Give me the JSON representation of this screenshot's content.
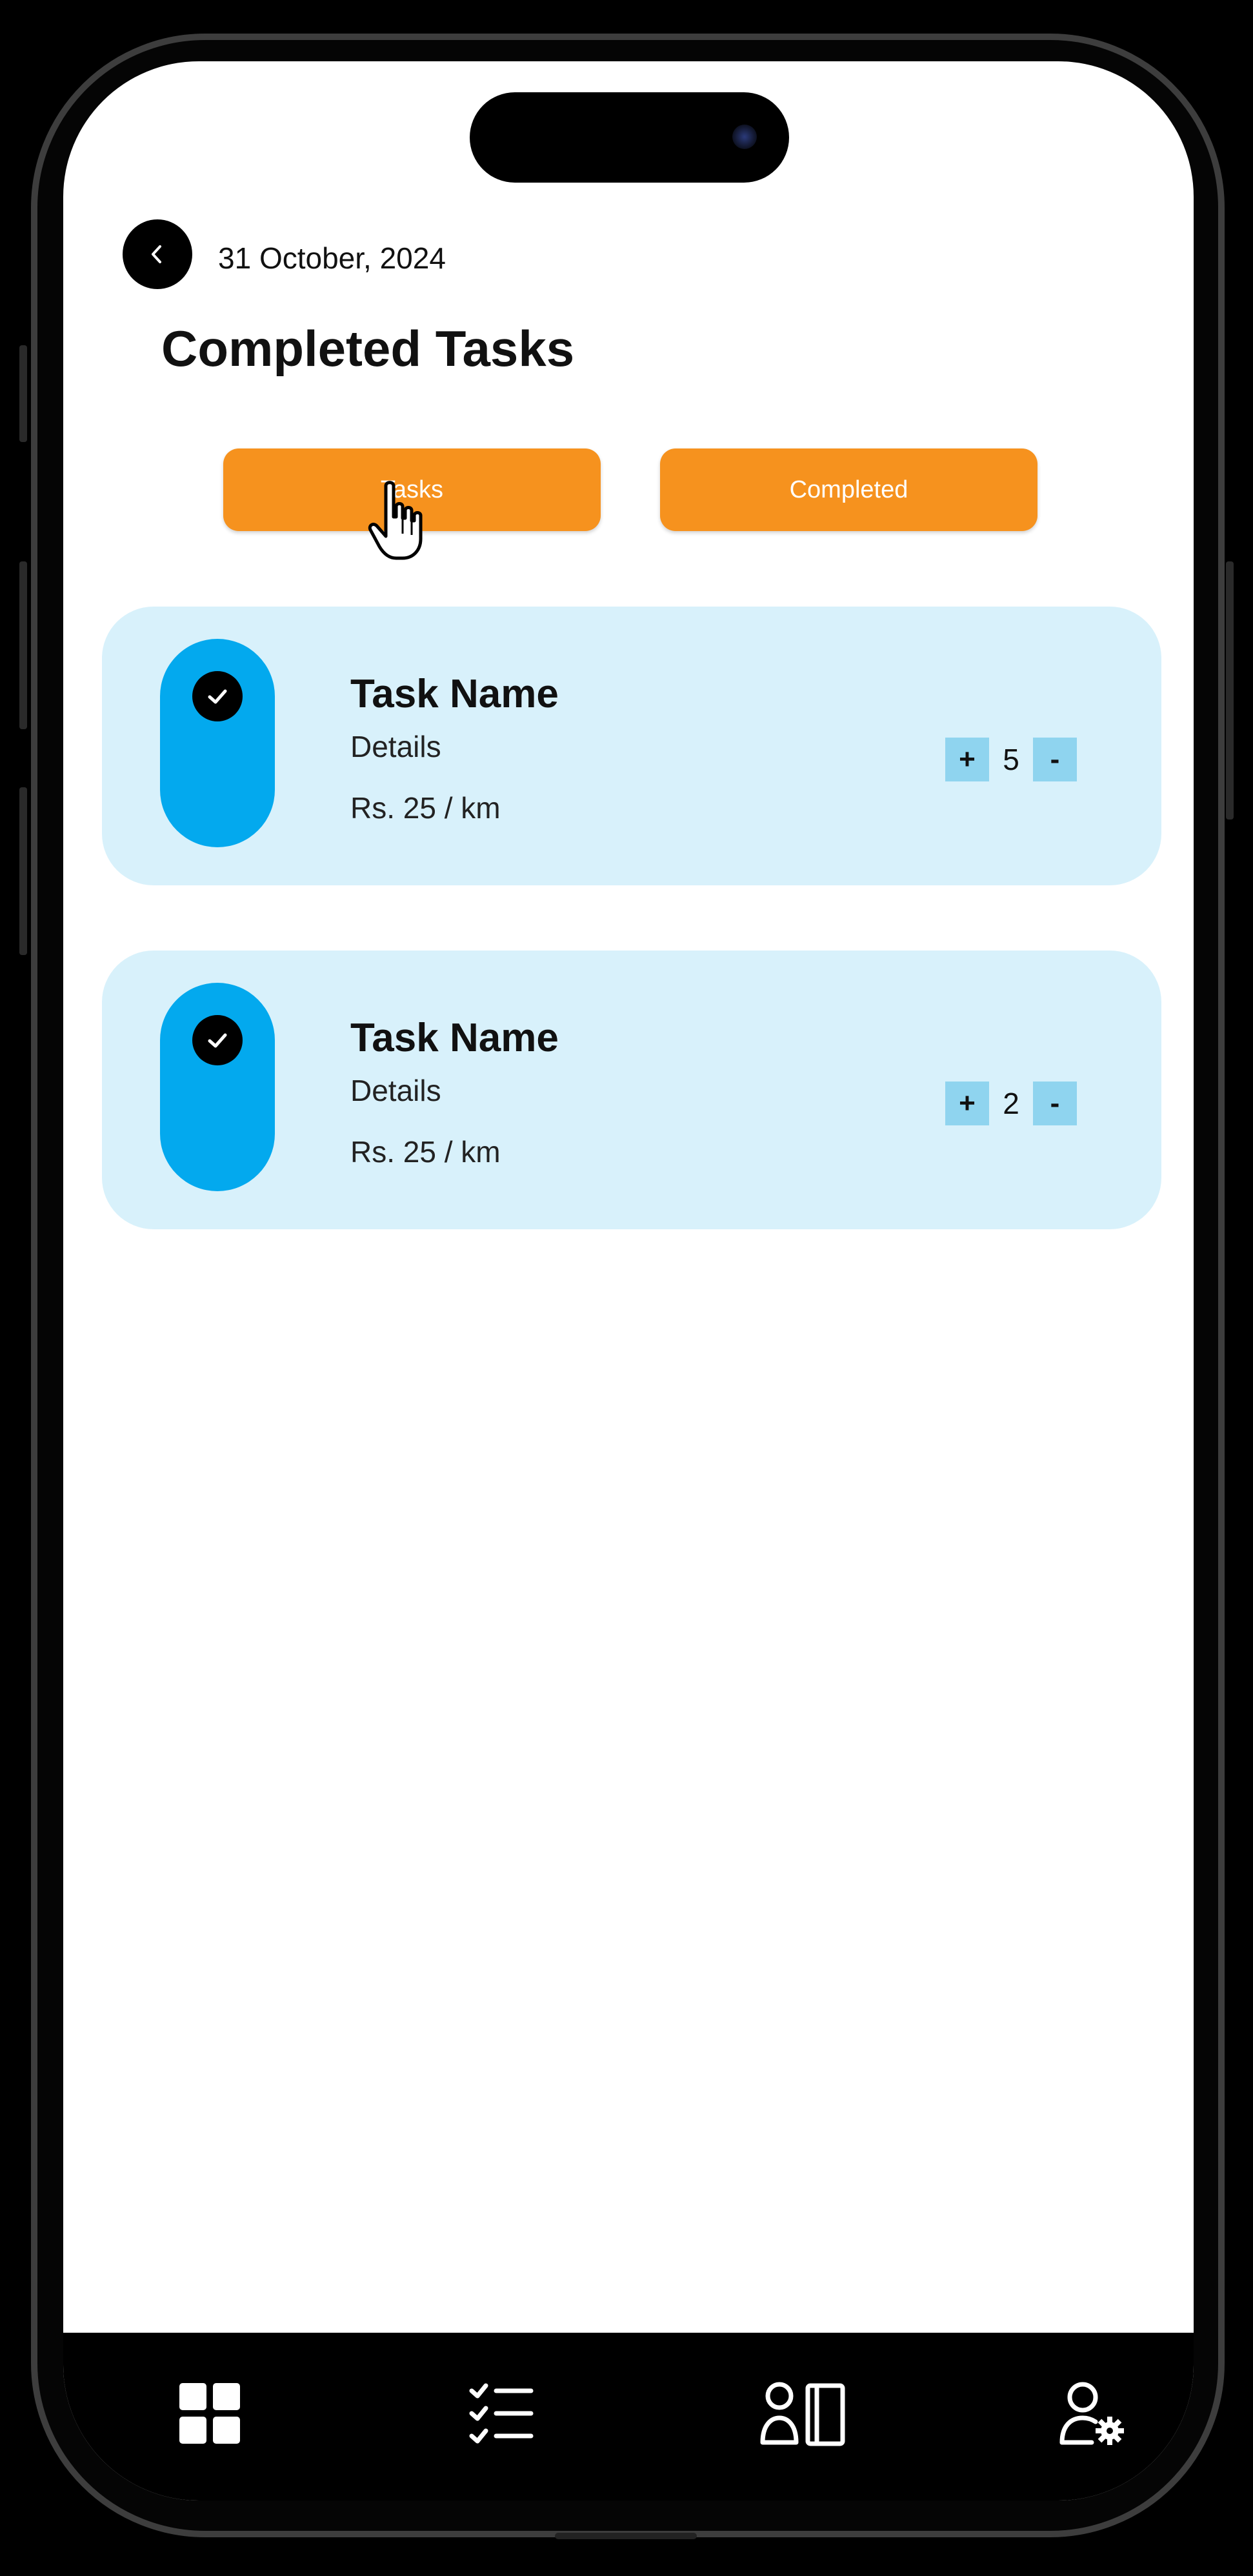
{
  "header": {
    "date": "31 October, 2024",
    "title": "Completed Tasks"
  },
  "tabs": [
    {
      "label": "Tasks"
    },
    {
      "label": "Completed"
    }
  ],
  "tasks": [
    {
      "name": "Task Name",
      "details": "Details",
      "rate": "Rs. 25 / km",
      "quantity": "5",
      "plus": "+",
      "minus": "-"
    },
    {
      "name": "Task Name",
      "details": "Details",
      "rate": "Rs. 25 / km",
      "quantity": "2",
      "plus": "+",
      "minus": "-"
    }
  ],
  "nav": {
    "items": [
      "dashboard-icon",
      "task-list-icon",
      "user-board-icon",
      "user-settings-icon"
    ]
  },
  "colors": {
    "accent": "#f6921e",
    "card": "#d8f1fb",
    "pill": "#03a9ee",
    "stepper": "#8fd4ef"
  }
}
